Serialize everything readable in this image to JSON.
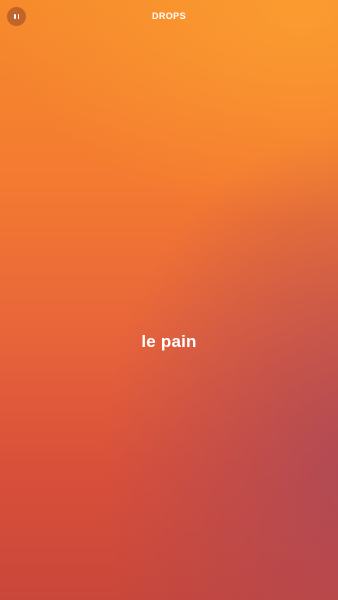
{
  "header": {
    "title": "DROPS",
    "pause_icon": "pause-icon"
  },
  "main": {
    "word": "le pain"
  },
  "colors": {
    "gradient_top": "#f68a2c",
    "gradient_bottom": "#c9473a",
    "accent_purple": "#a8485a",
    "text": "#ffffff"
  }
}
